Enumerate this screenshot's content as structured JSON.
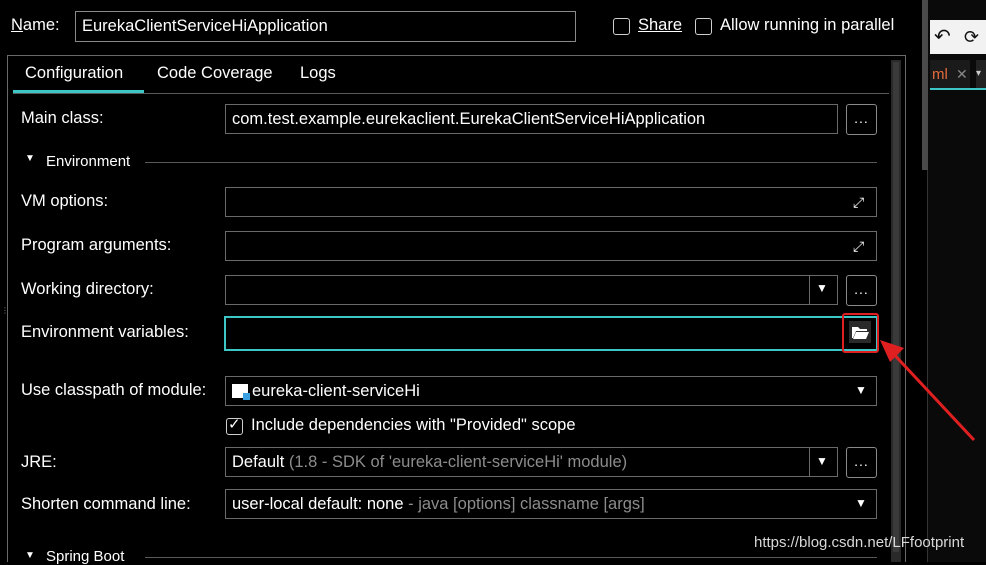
{
  "header": {
    "name_label_pre": "",
    "name_label_u": "N",
    "name_label_post": "ame:",
    "name_value": "EurekaClientServiceHiApplication",
    "share_label": "Share",
    "allow_parallel_label": "Allow running in parallel"
  },
  "tabs": [
    {
      "label": "Configuration",
      "active": true
    },
    {
      "label": "Code Coverage",
      "active": false
    },
    {
      "label": "Logs",
      "active": false
    }
  ],
  "form": {
    "main_class_label": "Main class:",
    "main_class_value": "com.test.example.eurekaclient.EurekaClientServiceHiApplication",
    "environment_section": "Environment",
    "vm_options_label": "VM options:",
    "program_args_label": "Program arguments:",
    "working_dir_label": "Working directory:",
    "env_vars_label": "Environment variables:",
    "classpath_label": "Use classpath of module:",
    "classpath_value": "eureka-client-serviceHi",
    "include_deps_label": "Include dependencies with \"Provided\" scope",
    "jre_label": "JRE:",
    "jre_value_main": "Default",
    "jre_value_hint": "(1.8 - SDK of 'eureka-client-serviceHi' module)",
    "shorten_label": "Shorten command line:",
    "shorten_value_main": "user-local default: none",
    "shorten_value_hint": "- java [options] classname [args]",
    "spring_boot_section": "Spring Boot",
    "browse_label": "..."
  },
  "side_panel": {
    "tab_text": "ml"
  },
  "watermark": "https://blog.csdn.net/LFfootprint",
  "colors": {
    "accent": "#3cc6c6",
    "highlight_red": "#e02020",
    "background": "#000000"
  }
}
